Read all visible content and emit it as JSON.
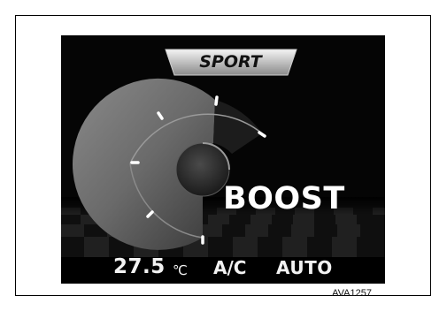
{
  "display": {
    "mode_label": "SPORT",
    "boost_label": "BOOST",
    "icons": [
      "boost-gauge-icon"
    ],
    "colors": {
      "background": "#050505",
      "text": "#f2f2f2"
    }
  },
  "status_bar": {
    "temperature": "27.5",
    "temperature_unit": "℃",
    "ac_label": "A/C",
    "mode_label": "AUTO"
  },
  "figure": {
    "code": "AVA1257"
  }
}
